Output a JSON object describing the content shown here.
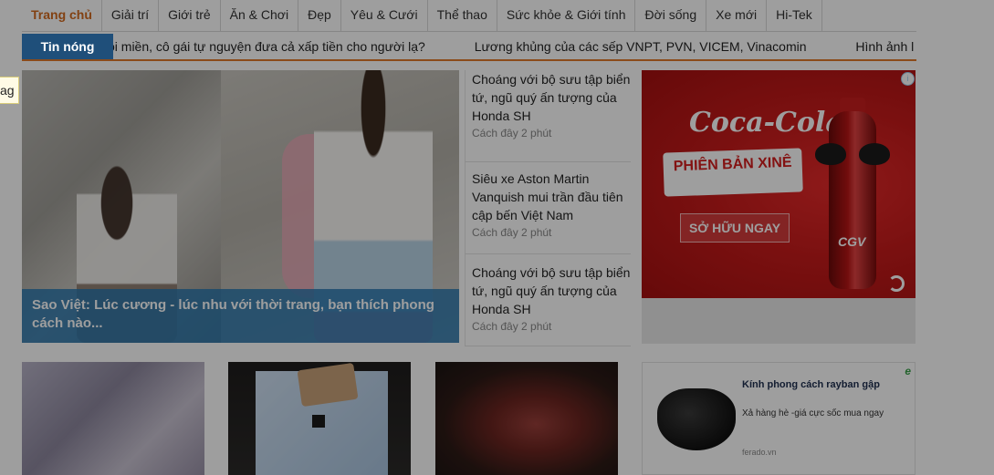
{
  "nav": {
    "items": [
      {
        "label": "Trang chủ",
        "active": true
      },
      {
        "label": "Giải trí"
      },
      {
        "label": "Giới trẻ"
      },
      {
        "label": "Ăn & Chơi"
      },
      {
        "label": "Đẹp"
      },
      {
        "label": "Yêu & Cưới"
      },
      {
        "label": "Thể thao"
      },
      {
        "label": "Sức khỏe & Giới tính"
      },
      {
        "label": "Đời sống"
      },
      {
        "label": "Xe mới"
      },
      {
        "label": "Hi-Tek"
      }
    ]
  },
  "ticker": {
    "label": "Tin nóng",
    "items": [
      "ôi miền, cô gái tự nguyện đưa cả xấp tiền cho người lạ?",
      "Lương khủng của các sếp VNPT, PVN, VICEM, Vinacomin",
      "Hình ảnh l"
    ]
  },
  "featured": {
    "caption": "Sao Việt: Lúc cương - lúc nhu với thời trang, bạn thích phong cách nào..."
  },
  "news": [
    {
      "title": "Choáng với bộ sưu tập biển tứ, ngũ quý ấn tượng của Honda SH",
      "time": "Cách đây 2 phút"
    },
    {
      "title": "Siêu xe Aston Martin Vanquish mui trần đầu tiên cập bến Việt Nam",
      "time": "Cách đây 2 phút"
    },
    {
      "title": "Choáng với bộ sưu tập biển tứ, ngũ quý ấn tượng của Honda SH",
      "time": "Cách đây 2 phút"
    }
  ],
  "ad": {
    "brand": "Coca-Cola",
    "edition": "PHIÊN BẢN XINÊ",
    "cta": "SỞ HỮU NGAY",
    "bottle_mark": "CGV",
    "info_icon": "info-icon",
    "replay_icon": "replay-icon"
  },
  "side_ad": {
    "title": "Kính phong cách rayban gập",
    "desc": "Xả hàng hè -giá cực sốc mua ngay",
    "domain": "ferado.vn",
    "badge": "e"
  },
  "tooltip": {
    "text": "ag"
  },
  "colors": {
    "nav_active": "#d2691e",
    "ticker_label_bg": "#1f4f7a",
    "ticker_border": "#e0792b",
    "caption_bg": "#2776af",
    "ad_red": "#c71b1b"
  }
}
